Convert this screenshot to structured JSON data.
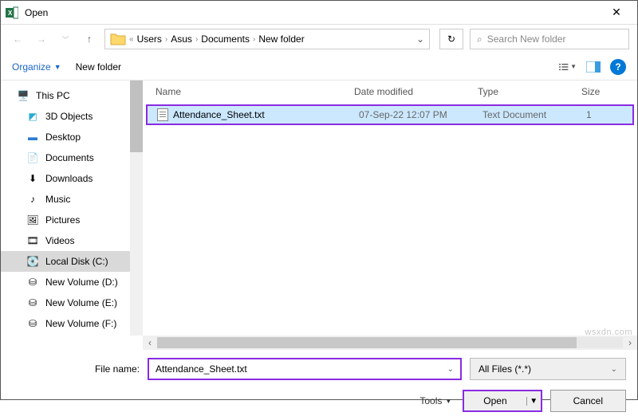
{
  "window": {
    "title": "Open",
    "close_glyph": "✕"
  },
  "nav": {
    "breadcrumb_prefix": "«",
    "crumbs": [
      "Users",
      "Asus",
      "Documents",
      "New folder"
    ],
    "search_placeholder": "Search New folder"
  },
  "toolbar": {
    "organize": "Organize",
    "new_folder": "New folder"
  },
  "tree": {
    "items": [
      {
        "label": "This PC",
        "icon": "pc"
      },
      {
        "label": "3D Objects",
        "icon": "3d"
      },
      {
        "label": "Desktop",
        "icon": "desktop"
      },
      {
        "label": "Documents",
        "icon": "docs"
      },
      {
        "label": "Downloads",
        "icon": "downloads"
      },
      {
        "label": "Music",
        "icon": "music"
      },
      {
        "label": "Pictures",
        "icon": "pictures"
      },
      {
        "label": "Videos",
        "icon": "videos"
      },
      {
        "label": "Local Disk (C:)",
        "icon": "disk",
        "selected": true
      },
      {
        "label": "New Volume (D:)",
        "icon": "drive"
      },
      {
        "label": "New Volume (E:)",
        "icon": "drive"
      },
      {
        "label": "New Volume (F:)",
        "icon": "drive"
      }
    ]
  },
  "list": {
    "headers": {
      "name": "Name",
      "date": "Date modified",
      "type": "Type",
      "size": "Size"
    },
    "rows": [
      {
        "name": "Attendance_Sheet.txt",
        "date": "07-Sep-22 12:07 PM",
        "type": "Text Document",
        "size": "1"
      }
    ]
  },
  "footer": {
    "filename_label": "File name:",
    "filename_value": "Attendance_Sheet.txt",
    "filter": "All Files (*.*)",
    "tools": "Tools",
    "open": "Open",
    "cancel": "Cancel"
  },
  "watermark": "wsxdn.com"
}
